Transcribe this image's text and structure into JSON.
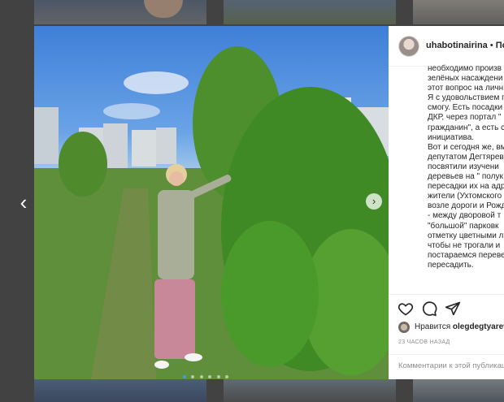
{
  "nav": {
    "prev_glyph": "‹"
  },
  "post": {
    "username": "uhabotinairina",
    "separator": "•",
    "follow_label": "Под",
    "caption_lines": [
      "необходимо произв",
      "зелёных насаждени",
      "этот вопрос на личн",
      "Я с удовольствием п",
      "смогу. Есть посадки",
      "ДКР, через портал \"",
      "гражданин\", а есть с",
      "инициатива.",
      "Вот и сегодня же, вм",
      "депутатом Дегтярев",
      "посвятили изучени",
      "деревьев на \" полук",
      "пересадки их на адр",
      "жители (Ухтомского",
      "возле дороги и Рожд",
      "- между дворовой т",
      "\"большой\" парковк",
      "отметку цветными л",
      "чтобы не трогали и",
      "постараемся переве",
      "пересадить."
    ],
    "likes_prefix": "Нравится",
    "likes_user": "olegdegtyarev",
    "time_ago": "23 ЧАСОВ НАЗАД",
    "comment_placeholder": "Комментарии к этой публикации"
  },
  "icons": {
    "like": "heart-icon",
    "comment": "comment-icon",
    "share": "paper-plane-icon",
    "next": "chevron-right-icon",
    "prev": "chevron-left-icon"
  },
  "carousel": {
    "count": 6,
    "active_index": 0
  },
  "colors": {
    "accent": "#3d9bf0",
    "text": "#262626",
    "muted": "#8e8e8e"
  }
}
